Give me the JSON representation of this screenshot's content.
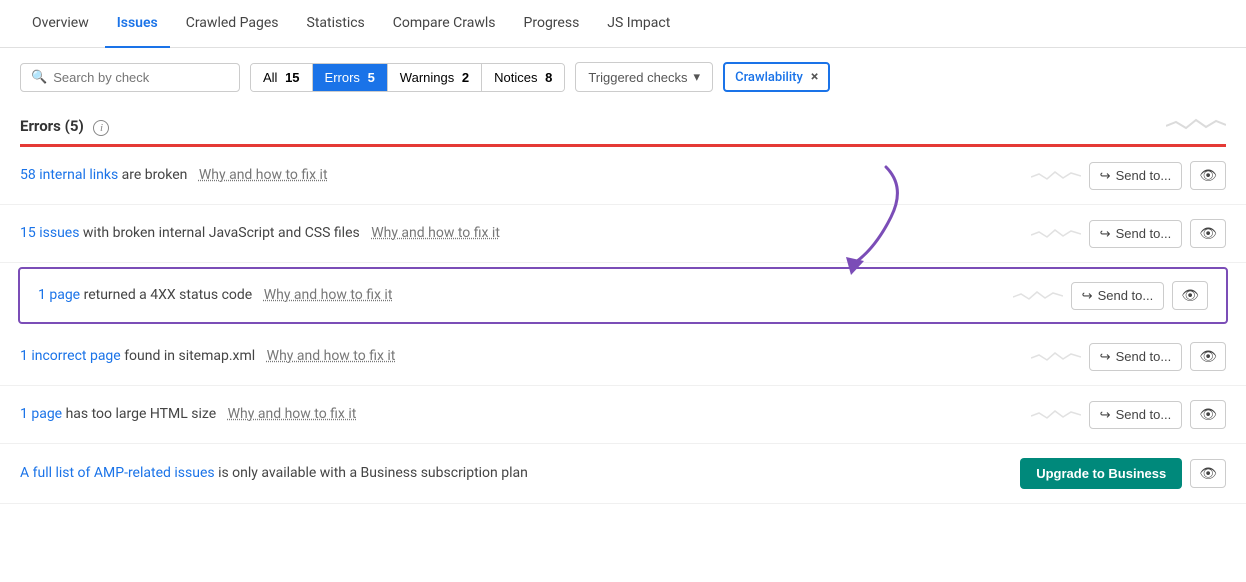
{
  "nav": {
    "items": [
      {
        "label": "Overview",
        "active": false
      },
      {
        "label": "Issues",
        "active": true
      },
      {
        "label": "Crawled Pages",
        "active": false
      },
      {
        "label": "Statistics",
        "active": false
      },
      {
        "label": "Compare Crawls",
        "active": false
      },
      {
        "label": "Progress",
        "active": false
      },
      {
        "label": "JS Impact",
        "active": false
      }
    ]
  },
  "toolbar": {
    "search_placeholder": "Search by check",
    "filters": [
      {
        "label": "All",
        "count": "15",
        "active": false
      },
      {
        "label": "Errors",
        "count": "5",
        "active": true
      },
      {
        "label": "Warnings",
        "count": "2",
        "active": false
      },
      {
        "label": "Notices",
        "count": "8",
        "active": false
      }
    ],
    "triggered_label": "Triggered checks",
    "crawlability_label": "Crawlability",
    "close_label": "×"
  },
  "section": {
    "title": "Errors",
    "count": "(5)",
    "info": "i"
  },
  "issues": [
    {
      "link_text": "58 internal links",
      "rest_text": " are broken",
      "fix_text": "Why and how to fix it",
      "highlighted": false,
      "send_label": "Send to...",
      "is_upgrade": false
    },
    {
      "link_text": "15 issues",
      "rest_text": " with broken internal JavaScript and CSS files",
      "fix_text": "Why and how to fix it",
      "highlighted": false,
      "send_label": "Send to...",
      "is_upgrade": false
    },
    {
      "link_text": "1 page",
      "rest_text": " returned a 4XX status code",
      "fix_text": "Why and how to fix it",
      "highlighted": true,
      "send_label": "Send to...",
      "is_upgrade": false
    },
    {
      "link_text": "1 incorrect page",
      "rest_text": " found in sitemap.xml",
      "fix_text": "Why and how to fix it",
      "highlighted": false,
      "send_label": "Send to...",
      "is_upgrade": false
    },
    {
      "link_text": "1 page",
      "rest_text": " has too large HTML size",
      "fix_text": "Why and how to fix it",
      "highlighted": false,
      "send_label": "Send to...",
      "is_upgrade": false
    }
  ],
  "upgrade_row": {
    "link_text": "A full list of AMP-related issues",
    "mid_text": " is only available with a Business subscription plan",
    "button_label": "Upgrade to Business"
  },
  "icons": {
    "search": "🔍",
    "send": "↪",
    "eye": "👁",
    "chevron_down": "▾",
    "info": "i"
  }
}
